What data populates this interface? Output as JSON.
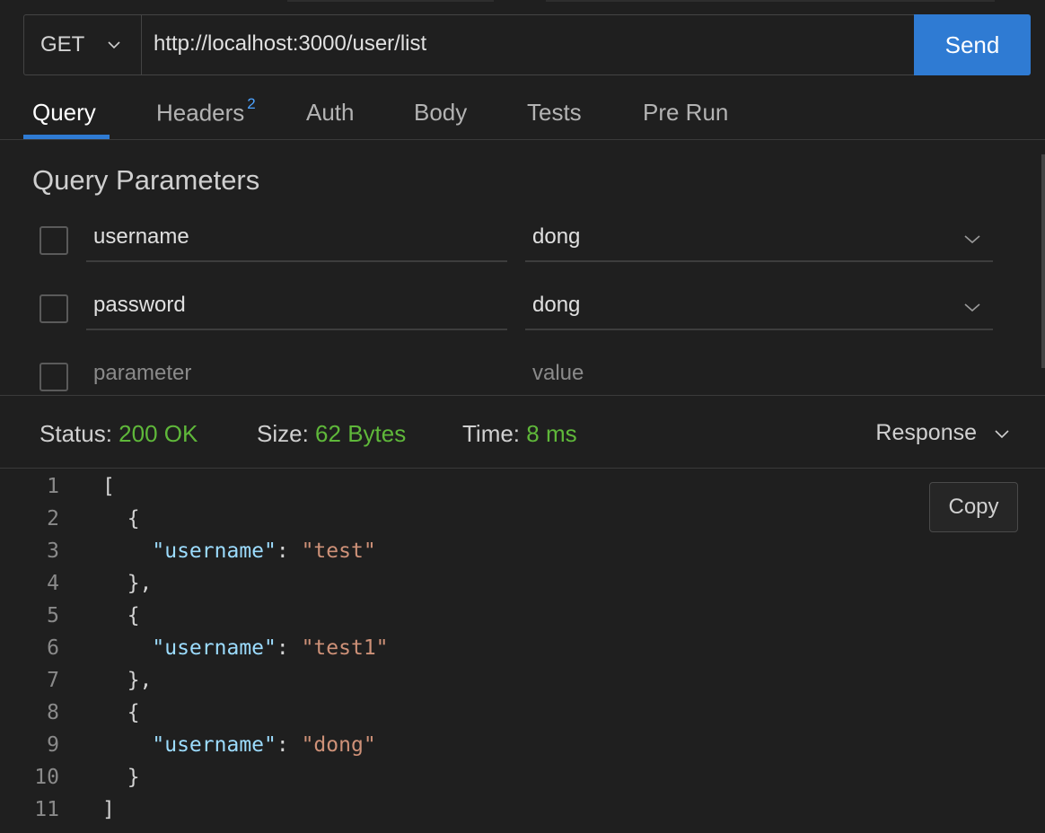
{
  "request": {
    "method": "GET",
    "url": "http://localhost:3000/user/list",
    "send_label": "Send"
  },
  "tabs": [
    {
      "label": "Query",
      "badge": ""
    },
    {
      "label": "Headers",
      "badge": "2"
    },
    {
      "label": "Auth",
      "badge": ""
    },
    {
      "label": "Body",
      "badge": ""
    },
    {
      "label": "Tests",
      "badge": ""
    },
    {
      "label": "Pre Run",
      "badge": ""
    }
  ],
  "query": {
    "title": "Query Parameters",
    "params": [
      {
        "name": "username",
        "value": "dong",
        "checked": false
      },
      {
        "name": "password",
        "value": "dong",
        "checked": false
      }
    ],
    "new_param_placeholder": "parameter",
    "new_value_placeholder": "value"
  },
  "status": {
    "status_label": "Status:",
    "status_value": "200 OK",
    "size_label": "Size:",
    "size_value": "62 Bytes",
    "time_label": "Time:",
    "time_value": "8 ms",
    "view_label": "Response"
  },
  "response": {
    "copy_label": "Copy",
    "lines": [
      {
        "n": "1",
        "parts": [
          {
            "t": "[",
            "c": ""
          }
        ]
      },
      {
        "n": "2",
        "parts": [
          {
            "t": "  {",
            "c": ""
          }
        ]
      },
      {
        "n": "3",
        "parts": [
          {
            "t": "    ",
            "c": ""
          },
          {
            "t": "\"username\"",
            "c": "key"
          },
          {
            "t": ": ",
            "c": ""
          },
          {
            "t": "\"test\"",
            "c": "str"
          }
        ]
      },
      {
        "n": "4",
        "parts": [
          {
            "t": "  },",
            "c": ""
          }
        ]
      },
      {
        "n": "5",
        "parts": [
          {
            "t": "  {",
            "c": ""
          }
        ]
      },
      {
        "n": "6",
        "parts": [
          {
            "t": "    ",
            "c": ""
          },
          {
            "t": "\"username\"",
            "c": "key"
          },
          {
            "t": ": ",
            "c": ""
          },
          {
            "t": "\"test1\"",
            "c": "str"
          }
        ]
      },
      {
        "n": "7",
        "parts": [
          {
            "t": "  },",
            "c": ""
          }
        ]
      },
      {
        "n": "8",
        "parts": [
          {
            "t": "  {",
            "c": ""
          }
        ]
      },
      {
        "n": "9",
        "parts": [
          {
            "t": "    ",
            "c": ""
          },
          {
            "t": "\"username\"",
            "c": "key"
          },
          {
            "t": ": ",
            "c": ""
          },
          {
            "t": "\"dong\"",
            "c": "str"
          }
        ]
      },
      {
        "n": "10",
        "parts": [
          {
            "t": "  }",
            "c": ""
          }
        ]
      },
      {
        "n": "11",
        "parts": [
          {
            "t": "]",
            "c": ""
          }
        ]
      }
    ]
  },
  "colors": {
    "accent": "#2f7bd3",
    "status_ok": "#5fb83a",
    "json_key": "#9cdcfe",
    "json_string": "#ce9178"
  }
}
